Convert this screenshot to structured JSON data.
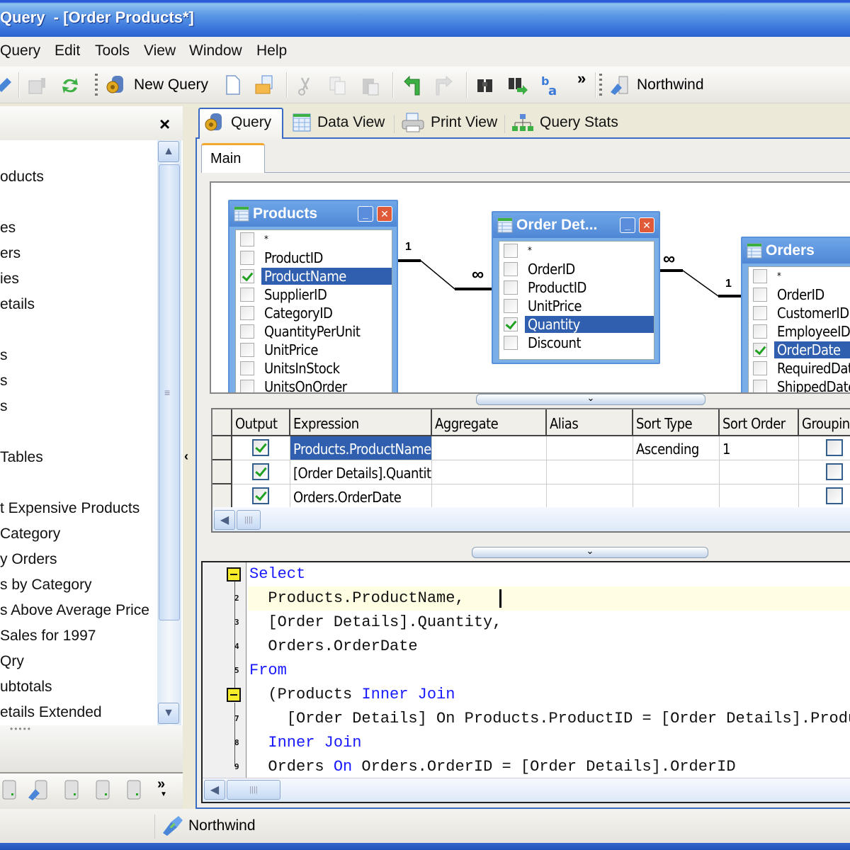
{
  "window": {
    "title": "Query  - [Order Products*]"
  },
  "menu": [
    "Query",
    "Edit",
    "Tools",
    "View",
    "Window",
    "Help"
  ],
  "toolbar": {
    "new_query_label": "New Query",
    "connection_label": "Northwind",
    "overflow": "»",
    "icons": [
      "connect-icon",
      "properties-icon",
      "refresh-icon",
      "new-query-icon",
      "new-file-icon",
      "open-file-icon",
      "cut-icon",
      "copy-icon",
      "paste-icon",
      "undo-icon",
      "redo-icon",
      "find-icon",
      "find-next-icon",
      "replace-icon",
      "database-connection-icon"
    ]
  },
  "left_panel": {
    "close_label": "×",
    "items": [
      "oducts",
      "",
      "es",
      "ers",
      "ies",
      "etails",
      "",
      "s",
      "s",
      "s",
      "",
      "Tables",
      "",
      "t Expensive Products",
      " Category",
      "y Orders",
      "s by Category",
      "s Above Average Price",
      " Sales for 1997",
      "Qry",
      "ubtotals",
      "etails Extended"
    ],
    "grip": "•••••",
    "overflow": "»"
  },
  "tabs": [
    {
      "label": "Query",
      "icon": "query-gear-icon",
      "active": true
    },
    {
      "label": "Data View",
      "icon": "grid-icon",
      "active": false
    },
    {
      "label": "Print View",
      "icon": "printer-icon",
      "active": false
    },
    {
      "label": "Query Stats",
      "icon": "hierarchy-icon",
      "active": false
    }
  ],
  "subtab": "Main",
  "diagram": {
    "tables": [
      {
        "name": "Products",
        "fields": [
          {
            "name": "*",
            "checked": false
          },
          {
            "name": "ProductID",
            "checked": false
          },
          {
            "name": "ProductName",
            "checked": true,
            "selected": true
          },
          {
            "name": "SupplierID",
            "checked": false
          },
          {
            "name": "CategoryID",
            "checked": false
          },
          {
            "name": "QuantityPerUnit",
            "checked": false
          },
          {
            "name": "UnitPrice",
            "checked": false
          },
          {
            "name": "UnitsInStock",
            "checked": false
          },
          {
            "name": "UnitsOnOrder",
            "checked": false
          }
        ]
      },
      {
        "name": "Order Det...",
        "fields": [
          {
            "name": "*",
            "checked": false
          },
          {
            "name": "OrderID",
            "checked": false
          },
          {
            "name": "ProductID",
            "checked": false
          },
          {
            "name": "UnitPrice",
            "checked": false
          },
          {
            "name": "Quantity",
            "checked": true,
            "selected": true
          },
          {
            "name": "Discount",
            "checked": false
          }
        ]
      },
      {
        "name": "Orders",
        "fields": [
          {
            "name": "*",
            "checked": false
          },
          {
            "name": "OrderID",
            "checked": false
          },
          {
            "name": "CustomerID",
            "checked": false
          },
          {
            "name": "EmployeeID",
            "checked": false
          },
          {
            "name": "OrderDate",
            "checked": true,
            "selected": true
          },
          {
            "name": "RequiredDate",
            "checked": false
          },
          {
            "name": "ShippedDate",
            "checked": false
          }
        ]
      }
    ],
    "relations": [
      {
        "from_label": "1",
        "to_label": "∞"
      },
      {
        "from_label": "∞",
        "to_label": "1"
      }
    ]
  },
  "grid": {
    "columns": [
      "Output",
      "Expression",
      "Aggregate",
      "Alias",
      "Sort Type",
      "Sort Order",
      "Grouping"
    ],
    "rows": [
      {
        "output": true,
        "expression": "Products.ProductName",
        "aggregate": "",
        "alias": "",
        "sort_type": "Ascending",
        "sort_order": "1",
        "grouping": false
      },
      {
        "output": true,
        "expression": "[Order Details].Quantity",
        "aggregate": "",
        "alias": "",
        "sort_type": "",
        "sort_order": "",
        "grouping": false
      },
      {
        "output": true,
        "expression": "Orders.OrderDate",
        "aggregate": "",
        "alias": "",
        "sort_type": "",
        "sort_order": "",
        "grouping": false
      }
    ]
  },
  "sql": {
    "line_numbers": [
      "",
      "2",
      "3",
      "4",
      "5",
      "",
      "7",
      "8",
      "9"
    ],
    "lines": [
      [
        {
          "t": "Select",
          "kw": true
        }
      ],
      [
        {
          "t": "  Products.ProductName,",
          "kw": false
        }
      ],
      [
        {
          "t": "  [Order Details].Quantity,",
          "kw": false
        }
      ],
      [
        {
          "t": "  Orders.OrderDate",
          "kw": false
        }
      ],
      [
        {
          "t": "From",
          "kw": true
        }
      ],
      [
        {
          "t": "  (Products ",
          "kw": false
        },
        {
          "t": "Inner Join",
          "kw": true
        }
      ],
      [
        {
          "t": "    [Order Details] On Products.ProductID = [Order Details].ProductID)",
          "kw": false
        }
      ],
      [
        {
          "t": "  ",
          "kw": false
        },
        {
          "t": "Inner Join",
          "kw": true
        }
      ],
      [
        {
          "t": "  Orders ",
          "kw": false
        },
        {
          "t": "On",
          "kw": true
        },
        {
          "t": " Orders.OrderID = [Order Details].OrderID",
          "kw": false
        }
      ]
    ]
  },
  "status": {
    "connection": "Northwind"
  },
  "colors": {
    "title_blue": "#2c62cf",
    "selection": "#2f5fae",
    "keyword": "#1a1aff",
    "current_line": "#fffde2",
    "fold_marker": "#f6ec2a",
    "check": "#21a121"
  }
}
